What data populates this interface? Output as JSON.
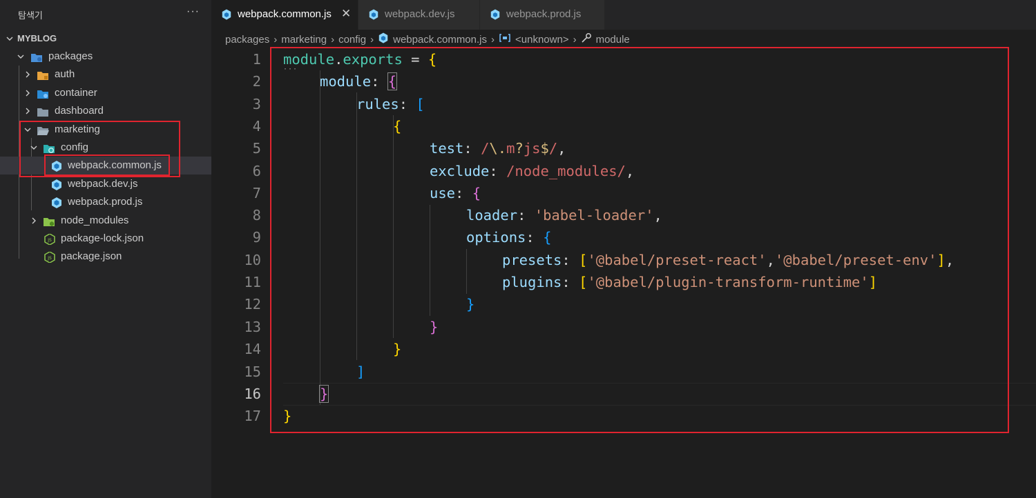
{
  "explorer": {
    "title": "탐색기",
    "more": "···",
    "root": "MYBLOG",
    "items": [
      {
        "label": "packages"
      },
      {
        "label": "auth"
      },
      {
        "label": "container"
      },
      {
        "label": "dashboard"
      },
      {
        "label": "marketing"
      },
      {
        "label": "config"
      },
      {
        "label": "webpack.common.js"
      },
      {
        "label": "webpack.dev.js"
      },
      {
        "label": "webpack.prod.js"
      },
      {
        "label": "node_modules"
      },
      {
        "label": "package-lock.json"
      },
      {
        "label": "package.json"
      }
    ]
  },
  "tabs": [
    {
      "label": "webpack.common.js",
      "close": "✕"
    },
    {
      "label": "webpack.dev.js"
    },
    {
      "label": "webpack.prod.js"
    }
  ],
  "breadcrumb": [
    "packages",
    "marketing",
    "config",
    "webpack.common.js",
    "<unknown>",
    "module"
  ],
  "editor": {
    "line_numbers": [
      "1",
      "2",
      "3",
      "4",
      "5",
      "6",
      "7",
      "8",
      "9",
      "10",
      "11",
      "12",
      "13",
      "14",
      "15",
      "16",
      "17"
    ],
    "current_line": "16",
    "code": {
      "l1": {
        "module": "module",
        "dot": ".",
        "exports": "exports",
        "eq": " = ",
        "brace": "{"
      },
      "l2": {
        "key": "module",
        "colon": ": ",
        "brace": "{"
      },
      "l3": {
        "key": "rules",
        "colon": ": ",
        "bracket": "["
      },
      "l4": {
        "brace": "{"
      },
      "l5": {
        "key": "test",
        "colon": ": ",
        "re1": "/",
        "re2": "\\.",
        "re3": "m",
        "re4": "?",
        "re5": "js",
        "re6": "$",
        "re7": "/",
        "comma": ","
      },
      "l6": {
        "key": "exclude",
        "colon": ": ",
        "re": "/node_modules/",
        "comma": ","
      },
      "l7": {
        "key": "use",
        "colon": ": ",
        "brace": "{"
      },
      "l8": {
        "key": "loader",
        "colon": ": ",
        "str": "'babel-loader'",
        "comma": ","
      },
      "l9": {
        "key": "options",
        "colon": ": ",
        "brace": "{"
      },
      "l10": {
        "key": "presets",
        "colon": ": ",
        "open": "[",
        "s1": "'@babel/preset-react'",
        "sep": ",",
        "s2": "'@babel/preset-env'",
        "close": "]",
        "comma": ","
      },
      "l11": {
        "key": "plugins",
        "colon": ": ",
        "open": "[",
        "s1": "'@babel/plugin-transform-runtime'",
        "close": "]"
      },
      "l12": {
        "brace": "}"
      },
      "l13": {
        "brace": "}"
      },
      "l14": {
        "brace": "}"
      },
      "l15": {
        "bracket": "]"
      },
      "l16": {
        "brace": "}"
      },
      "l17": {
        "brace": "}"
      }
    }
  },
  "colors": {
    "highlight_box": "#e0242f",
    "editor_bg": "#1e1e1e",
    "sidebar_bg": "#252526"
  }
}
